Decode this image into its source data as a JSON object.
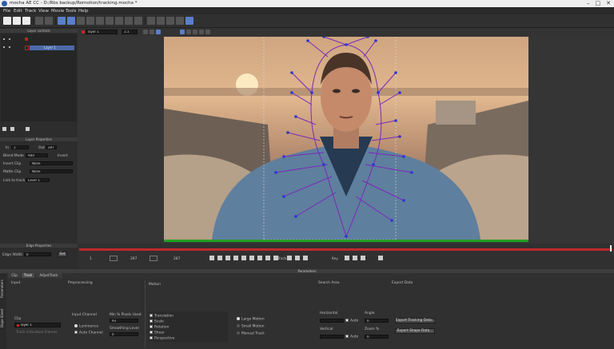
{
  "window": {
    "title": "mocha AE CC - D:/Rbs backup/Romotion/tracking.mocha *"
  },
  "window_controls": [
    "–",
    "□",
    "✕"
  ],
  "menu": [
    "File",
    "Edit",
    "Track",
    "View",
    "Movie",
    "Tools",
    "Help"
  ],
  "viewer": {
    "layer_select": "layer 1",
    "zoom": "1:1"
  },
  "layer_controls": {
    "header": "Layer controls",
    "layer_name": "Layer 1"
  },
  "layer_properties": {
    "header": "Layer Properties",
    "in_label": "In",
    "in_value": "1",
    "out_label": "Out",
    "out_value": "287",
    "blend_mode_label": "Blend Mode",
    "blend_mode_value": "Add",
    "invert_label": "Invert",
    "insert_clip_label": "Insert Clip",
    "insert_clip_value": "None",
    "matte_clip_label": "Matte Clip",
    "matte_clip_value": "None",
    "link_to_track_label": "Link to track",
    "link_to_track_value": "Layer 1"
  },
  "edge_properties": {
    "header": "Edge Properties",
    "edge_width_label": "Edge Width",
    "edge_width_value": "0",
    "set_label": "Set"
  },
  "timeline": {
    "start_frame": "1",
    "current_frame": "287",
    "end_frame": "287",
    "track_label": "Track",
    "key_label": "Key"
  },
  "params": {
    "header": "Parameters",
    "side_tabs": [
      "Parameters",
      "Dope Sheet"
    ],
    "tabs": [
      "Clip",
      "Track",
      "AdjustTrack"
    ],
    "input": {
      "header": "Input",
      "clip_value": "layer 1",
      "clip_label": "Clip",
      "track_all_label": "Track individual Frames"
    },
    "preprocessing": {
      "header": "Preprocessing",
      "input_channel_label": "Input Channel",
      "luminance": "Luminance",
      "auto_channel": "Auto Channel",
      "min_pixels_label": "Min % Pixels Used",
      "min_pixels_value": "93",
      "smoothing_label": "Smoothing Level",
      "smoothing_value": "0"
    },
    "motion": {
      "header": "Motion",
      "options": [
        "Translation",
        "Scale",
        "Rotation",
        "Shear",
        "Perspective"
      ],
      "large_motion": "Large Motion",
      "small_motion": "Small Motion",
      "manual_track": "Manual Track"
    },
    "search_area": {
      "header": "Search Area",
      "horizontal_label": "Horizontal",
      "vertical_label": "Vertical",
      "auto_label": "Auto",
      "angle_label": "Angle",
      "angle_value": "0",
      "zoom_label": "Zoom %",
      "zoom_value": "0"
    },
    "export": {
      "header": "Export Data",
      "tracking_button": "Export Tracking Data...",
      "shape_button": "Export Shape Data..."
    }
  }
}
